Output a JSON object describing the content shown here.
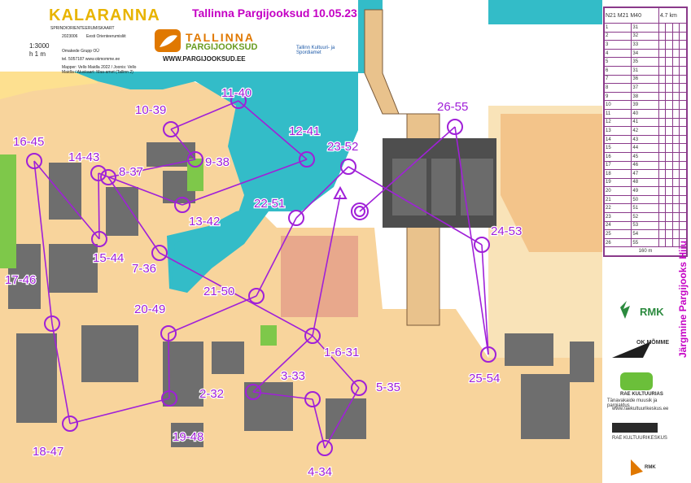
{
  "header": {
    "map_title": "KALARANNA",
    "map_subtitle": "SPRINDIORIENTEERUMISKAART",
    "event_title": "Tallinna Pargijooksud 10.05.23",
    "scale": "1:3000",
    "equidistance": "h 1 m",
    "map_year": "2023006",
    "club_text": "Eesti Orienteerumisliit",
    "printer": "Omakede Grupp OÜ",
    "phone": "tel. 5057187  www.okmomme.ee",
    "credits": "Mapper: Vello Maidla 2022 / Joonis: Vello Maidla / Aluskaart: Maa-amet (Tallinn 2)",
    "brand_line1": "TALLINNA",
    "brand_line2": "PARGIJOOKSUD",
    "url": "WWW.PARGIJOOKSUD.EE",
    "city_logo": "Tallinn Kultuuri- ja Spordiamet"
  },
  "side_text": "Järgmine Pargijooks Hiiu",
  "sponsors": {
    "rmk": "RMK",
    "ok_momme": "OK MÕMME",
    "rae_name": "RAE KULTUURIAS",
    "rae_line": "Tänavakaide muusik ja pargialdus",
    "rae_url": "www.raekultuurikeskus.ee",
    "kultuur": "RAE KULTUURIKESKUS",
    "rmk_small": "RMK"
  },
  "control_description": {
    "classes": "N21 M21 M40",
    "length": "4.7 km",
    "finish_distance": "160 m",
    "rows": [
      {
        "no": "1",
        "code": "31"
      },
      {
        "no": "2",
        "code": "32"
      },
      {
        "no": "3",
        "code": "33"
      },
      {
        "no": "4",
        "code": "34"
      },
      {
        "no": "5",
        "code": "35"
      },
      {
        "no": "6",
        "code": "31"
      },
      {
        "no": "7",
        "code": "36"
      },
      {
        "no": "8",
        "code": "37"
      },
      {
        "no": "9",
        "code": "38"
      },
      {
        "no": "10",
        "code": "39"
      },
      {
        "no": "11",
        "code": "40"
      },
      {
        "no": "12",
        "code": "41"
      },
      {
        "no": "13",
        "code": "42"
      },
      {
        "no": "14",
        "code": "43"
      },
      {
        "no": "15",
        "code": "44"
      },
      {
        "no": "16",
        "code": "45"
      },
      {
        "no": "17",
        "code": "46"
      },
      {
        "no": "18",
        "code": "47"
      },
      {
        "no": "19",
        "code": "48"
      },
      {
        "no": "20",
        "code": "49"
      },
      {
        "no": "21",
        "code": "50"
      },
      {
        "no": "22",
        "code": "51"
      },
      {
        "no": "23",
        "code": "52"
      },
      {
        "no": "24",
        "code": "53"
      },
      {
        "no": "25",
        "code": "54"
      },
      {
        "no": "26",
        "code": "55"
      }
    ]
  },
  "course": {
    "start_symbol": "triangle",
    "finish_symbol": "double-circle",
    "color": "#a020d8",
    "controls": [
      {
        "label": "1-6-31"
      },
      {
        "label": "2-32"
      },
      {
        "label": "3-33"
      },
      {
        "label": "4-34"
      },
      {
        "label": "5-35"
      },
      {
        "label": "7-36"
      },
      {
        "label": "8-37"
      },
      {
        "label": "9-38"
      },
      {
        "label": "10-39"
      },
      {
        "label": "11-40"
      },
      {
        "label": "12-41"
      },
      {
        "label": "13-42"
      },
      {
        "label": "14-43"
      },
      {
        "label": "15-44"
      },
      {
        "label": "16-45"
      },
      {
        "label": "17-46"
      },
      {
        "label": "18-47"
      },
      {
        "label": "19-48"
      },
      {
        "label": "20-49"
      },
      {
        "label": "21-50"
      },
      {
        "label": "22-51"
      },
      {
        "label": "23-52"
      },
      {
        "label": "24-53"
      },
      {
        "label": "25-54"
      },
      {
        "label": "26-55"
      }
    ]
  },
  "colors": {
    "water": "#33bcc8",
    "paved": "#f5c88a",
    "open": "#fde090",
    "building": "#707070",
    "forest": "#ffffff",
    "green": "#7ec84a",
    "course": "#a020d8"
  }
}
